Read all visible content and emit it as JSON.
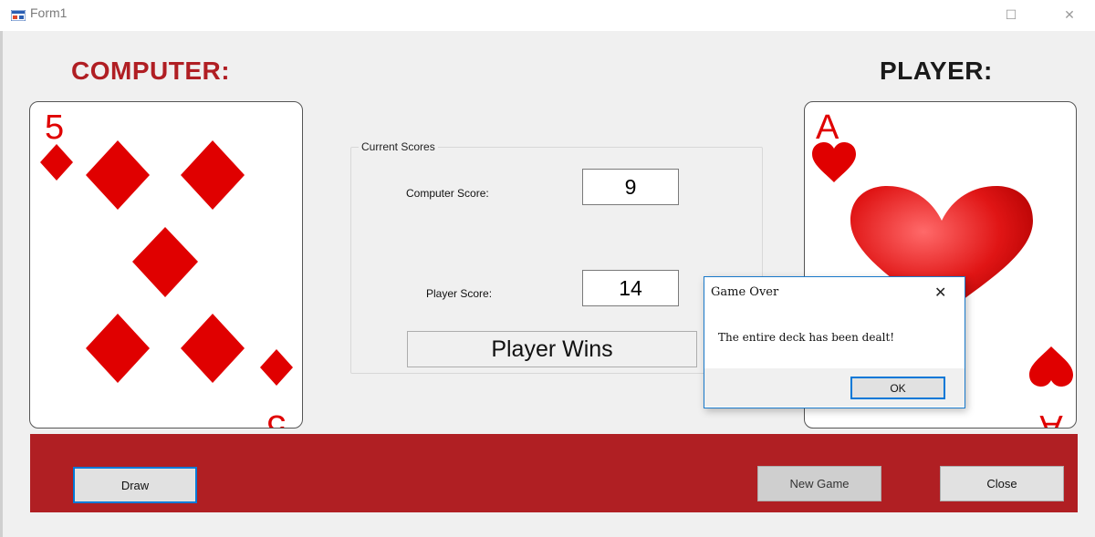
{
  "window": {
    "title": "Form1",
    "maximize_glyph": "☐",
    "close_glyph": "✕"
  },
  "computer": {
    "heading": "COMPUTER:",
    "card": {
      "rank": "5",
      "suit": "diamonds",
      "color": "#e00000"
    }
  },
  "player": {
    "heading": "PLAYER:",
    "card": {
      "rank": "A",
      "suit": "hearts",
      "color": "#e00000"
    }
  },
  "scores": {
    "group_title": "Current Scores",
    "computer_label": "Computer Score:",
    "computer_value": "9",
    "player_label": "Player Score:",
    "player_value": "14",
    "result": "Player Wins"
  },
  "buttons": {
    "draw": "Draw",
    "new_game": "New Game",
    "close": "Close"
  },
  "dialog": {
    "title": "Game Over",
    "close_glyph": "✕",
    "message": "The entire deck has been dealt!",
    "ok": "OK"
  },
  "colors": {
    "panel": "#b01f23",
    "accent": "#0078d7",
    "card_red": "#e00000"
  }
}
